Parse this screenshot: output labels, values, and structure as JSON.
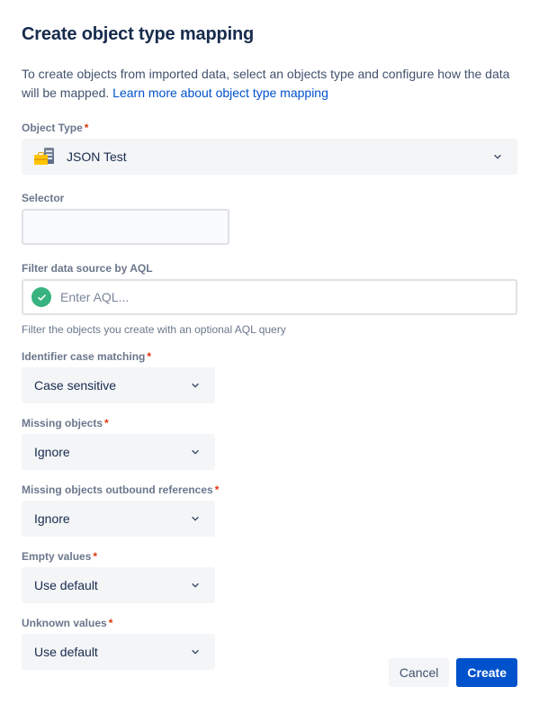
{
  "dialog": {
    "title": "Create object type mapping",
    "description_part1": "To create objects from imported data, select an objects type and configure how the data will be mapped. ",
    "link_label": "Learn more about object type mapping"
  },
  "fields": {
    "object_type": {
      "label": "Object Type",
      "required_marker": "*",
      "value": "JSON Test",
      "icon": "object-type-icon",
      "chevron": "chevron-down-icon"
    },
    "selector": {
      "label": "Selector",
      "value": "",
      "placeholder": ""
    },
    "aql": {
      "label": "Filter data source by AQL",
      "value": "",
      "placeholder": "Enter AQL...",
      "status_icon": "check-circle-icon",
      "status_color": "#36b37e",
      "helper_text": "Filter the objects you create with an optional AQL query"
    },
    "identifier_case_matching": {
      "label": "Identifier case matching",
      "required_marker": "*",
      "value": "Case sensitive",
      "chevron": "chevron-down-icon"
    },
    "missing_objects": {
      "label": "Missing objects",
      "required_marker": "*",
      "value": "Ignore",
      "chevron": "chevron-down-icon"
    },
    "missing_objects_outbound_references": {
      "label": "Missing objects outbound references",
      "required_marker": "*",
      "value": "Ignore",
      "chevron": "chevron-down-icon"
    },
    "empty_values": {
      "label": "Empty values",
      "required_marker": "*",
      "value": "Use default",
      "chevron": "chevron-down-icon"
    },
    "unknown_values": {
      "label": "Unknown values",
      "required_marker": "*",
      "value": "Use default",
      "chevron": "chevron-down-icon"
    }
  },
  "footer": {
    "cancel_label": "Cancel",
    "create_label": "Create"
  },
  "colors": {
    "primary": "#0052cc",
    "link": "#0052cc",
    "required": "#de350b",
    "success": "#36b37e",
    "field_background": "#f4f5f7"
  }
}
